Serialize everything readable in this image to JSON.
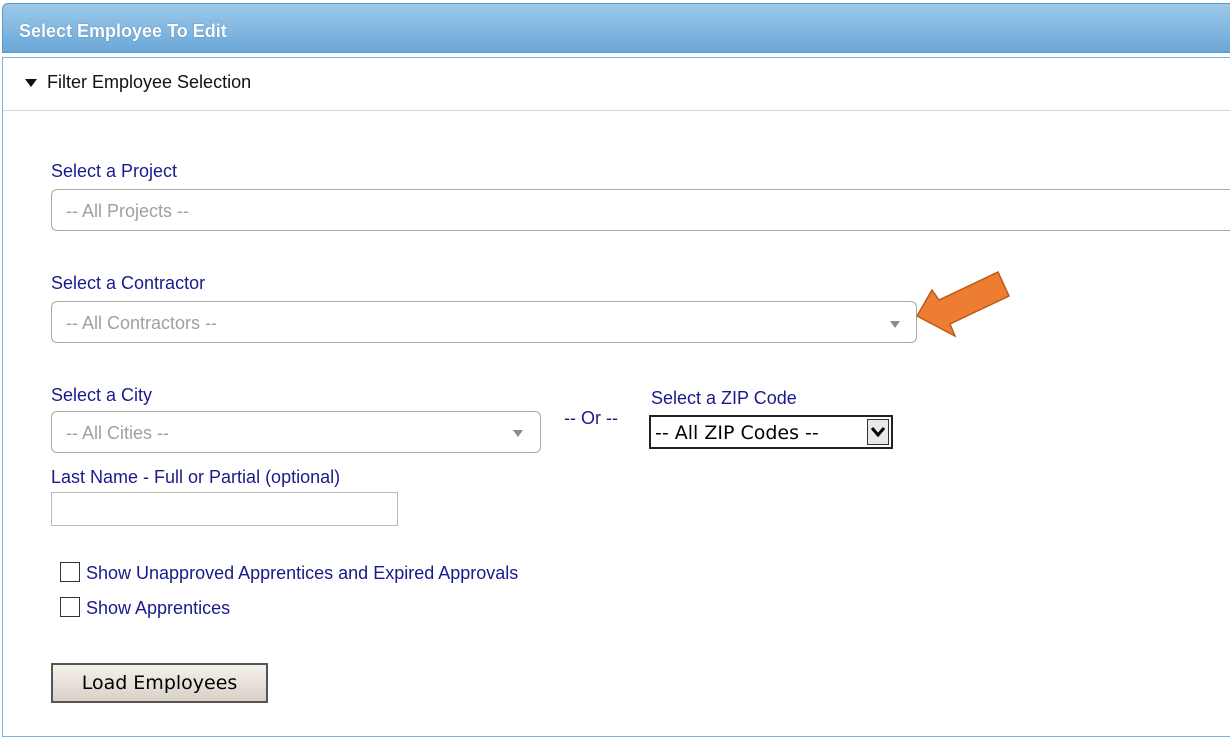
{
  "header": {
    "title": "Select Employee To Edit"
  },
  "filter": {
    "title": "Filter Employee Selection"
  },
  "project": {
    "label": "Select a Project",
    "value": "-- All Projects --"
  },
  "contractor": {
    "label": "Select a Contractor",
    "value": "-- All Contractors --"
  },
  "city": {
    "label": "Select a City",
    "value": "-- All Cities --"
  },
  "or_text": "-- Or --",
  "zip": {
    "label": "Select a ZIP Code",
    "value": "-- All ZIP Codes --"
  },
  "last_name": {
    "label": "Last Name - Full or Partial (optional)",
    "value": ""
  },
  "checkboxes": [
    {
      "label": "Show Unapproved Apprentices and Expired Approvals",
      "checked": false
    },
    {
      "label": "Show Apprentices",
      "checked": false
    }
  ],
  "load_button": {
    "label": "Load Employees"
  },
  "colors": {
    "header": "#6aa7d8",
    "label": "#1a1a8c",
    "annotation_arrow": "#ed7d31"
  }
}
